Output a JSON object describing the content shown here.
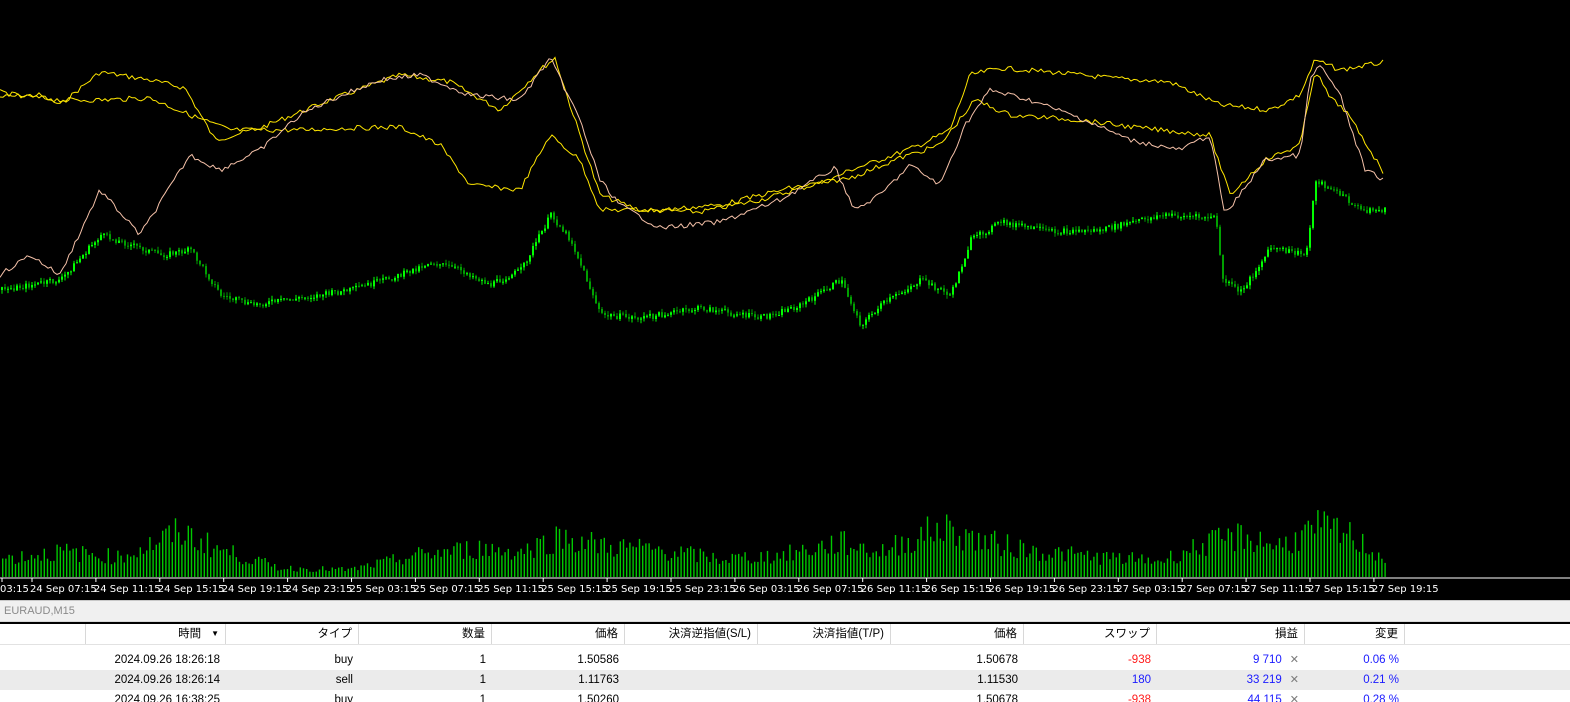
{
  "chart": {
    "colors": {
      "background": "#000000",
      "candle": "#00ff00",
      "candle_dark": "#00a000",
      "volume": "#00c800",
      "line_yellow": "#ffe600",
      "line_pink": "#f5c1a8"
    },
    "time_labels": [
      "03:15",
      "24 Sep 07:15",
      "24 Sep 11:15",
      "24 Sep 15:15",
      "24 Sep 19:15",
      "24 Sep 23:15",
      "25 Sep 03:15",
      "25 Sep 07:15",
      "25 Sep 11:15",
      "25 Sep 15:15",
      "25 Sep 19:15",
      "25 Sep 23:15",
      "26 Sep 03:15",
      "26 Sep 07:15",
      "26 Sep 11:15",
      "26 Sep 15:15",
      "26 Sep 19:15",
      "26 Sep 23:15",
      "27 Sep 03:15",
      "27 Sep 07:15",
      "27 Sep 11:15",
      "27 Sep 15:15",
      "27 Sep 19:15"
    ]
  },
  "symbol_bar": {
    "label": "EURAUD,M15"
  },
  "table": {
    "headers": [
      "時間",
      "タイプ",
      "数量",
      "価格",
      "決済逆指値(S/L)",
      "決済指値(T/P)",
      "価格",
      "スワップ",
      "損益",
      "変更"
    ],
    "sort_icon": "sort-down-arrow-icon",
    "rows": [
      {
        "time": "2024.09.26 18:26:18",
        "type": "buy",
        "volume": "1",
        "price": "1.50586",
        "sl": "",
        "tp": "",
        "current_price": "1.50678",
        "swap": "-938",
        "profit": "9 710",
        "change": "0.06 %"
      },
      {
        "time": "2024.09.26 18:26:14",
        "type": "sell",
        "volume": "1",
        "price": "1.11763",
        "sl": "",
        "tp": "",
        "current_price": "1.11530",
        "swap": "180",
        "profit": "33 219",
        "change": "0.21 %"
      },
      {
        "time": "2024.09.26 16:38:25",
        "type": "buy",
        "volume": "1",
        "price": "1.50260",
        "sl": "",
        "tp": "",
        "current_price": "1.50678",
        "swap": "-938",
        "profit": "44 115",
        "change": "0.28 %"
      }
    ]
  }
}
